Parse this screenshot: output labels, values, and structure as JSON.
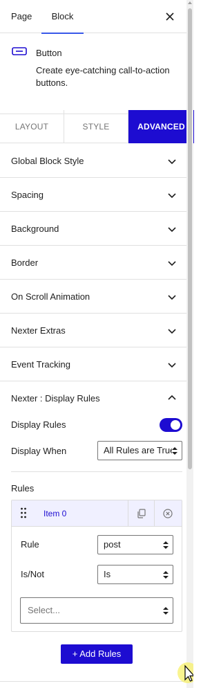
{
  "header": {
    "tabs": [
      {
        "label": "Page",
        "active": false
      },
      {
        "label": "Block",
        "active": true
      }
    ],
    "close_icon": "close-icon"
  },
  "block_card": {
    "name": "Button",
    "description": "Create eye-catching call-to-action buttons.",
    "icon": "button-block-icon"
  },
  "style_tabs": [
    {
      "label": "LAYOUT",
      "active": false
    },
    {
      "label": "STYLE",
      "active": false
    },
    {
      "label": "ADVANCED",
      "active": true
    }
  ],
  "panels": [
    {
      "label": "Global Block Style"
    },
    {
      "label": "Spacing"
    },
    {
      "label": "Background"
    },
    {
      "label": "Border"
    },
    {
      "label": "On Scroll Animation"
    },
    {
      "label": "Nexter Extras"
    },
    {
      "label": "Event Tracking"
    }
  ],
  "display_rules_panel": {
    "title": "Nexter : Display Rules",
    "expanded": true,
    "display_rules_label": "Display Rules",
    "display_rules_enabled": true,
    "display_when_label": "Display When",
    "display_when_value": "All Rules are True",
    "rules_label": "Rules",
    "items": [
      {
        "title": "Item 0",
        "rule_label": "Rule",
        "rule_value": "post",
        "isnot_label": "Is/Not",
        "isnot_value": "Is",
        "select_placeholder": "Select..."
      }
    ],
    "add_button_label": "+ Add Rules"
  },
  "colors": {
    "accent": "#1d0cd1",
    "tab_underline": "#3858e9",
    "item_header_bg": "#f0f0ff"
  }
}
